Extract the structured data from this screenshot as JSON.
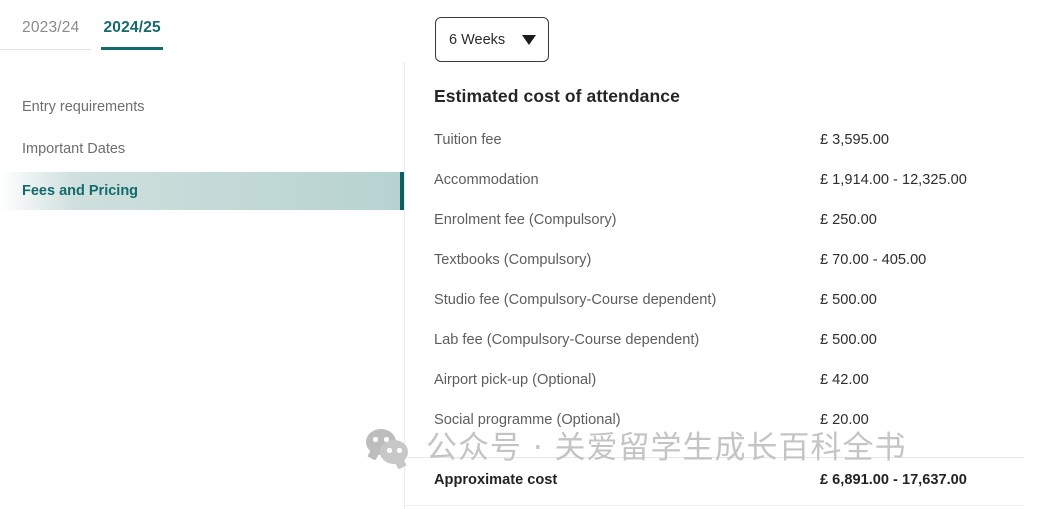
{
  "year_tabs": [
    {
      "label": "2023/24",
      "active": false
    },
    {
      "label": "2024/25",
      "active": true
    }
  ],
  "sidebar": {
    "items": [
      {
        "label": "Entry requirements",
        "active": false
      },
      {
        "label": "Important Dates",
        "active": false
      },
      {
        "label": "Fees and Pricing",
        "active": true
      }
    ]
  },
  "duration_select": {
    "value": "6 Weeks",
    "caret_icon": "chevron-down-icon"
  },
  "main": {
    "heading": "Estimated cost of attendance",
    "rows": [
      {
        "label": "Tuition fee",
        "value": "£ 3,595.00"
      },
      {
        "label": "Accommodation",
        "value": "£ 1,914.00 - 12,325.00"
      },
      {
        "label": "Enrolment fee (Compulsory)",
        "value": "£ 250.00"
      },
      {
        "label": "Textbooks (Compulsory)",
        "value": "£ 70.00 - 405.00"
      },
      {
        "label": "Studio fee (Compulsory-Course dependent)",
        "value": "£ 500.00"
      },
      {
        "label": "Lab fee (Compulsory-Course dependent)",
        "value": "£ 500.00"
      },
      {
        "label": "Airport pick-up (Optional)",
        "value": "£ 42.00"
      },
      {
        "label": "Social programme (Optional)",
        "value": "£ 20.00"
      }
    ],
    "total": {
      "label": "Approximate cost",
      "value": "£ 6,891.00 - 17,637.00"
    }
  },
  "watermark": {
    "icon": "wechat-icon",
    "text": "公众号 · 关爱留学生成长百科全书"
  },
  "colors": {
    "accent_teal": "#156a6c",
    "accent_bar": "#0d5f63",
    "highlight_gradient_end": "#b6d2d0",
    "label_gray": "#5e5e5e",
    "value_dark": "#2e2e2e",
    "watermark_gray": "#c4c4c4"
  }
}
